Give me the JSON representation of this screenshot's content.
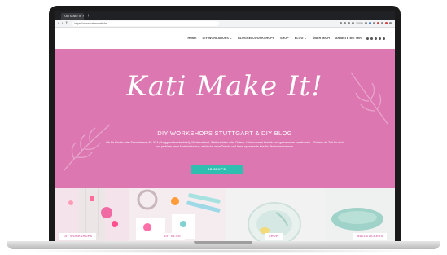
{
  "browser": {
    "tab_title": "Kati Make It! ×",
    "new_tab": "+",
    "url": "https://www.katimakeit.de",
    "zoom": "100%"
  },
  "nav": {
    "items": [
      "HOME",
      "DIY WORKSHOPS ⌄",
      "BLOGGER-WORKSHOPS",
      "SHOP",
      "BLOG ⌄",
      "ÜBER MICH",
      "ARBEITE MIT MIR"
    ]
  },
  "hero": {
    "logo": "Kati Make It!",
    "title": "DIY WORKSHOPS STUTTGART & DIY BLOG",
    "text": "Ob für Kinder oder Erwachsene, für JGA (Junggesellenabschied), Mädelsabend, Weihnachten oder Ostern: Unbeschwert basteln und gemeinsam kreativ sein – Schenk dir Zeit für dich und probiere neue Materialien aus, entdecke neue Trends und lerne spannende Kreativ-Techniken kennen.",
    "cta": "SO GEHT'S",
    "background": "#dd77b2",
    "button_color": "#2fbeb0"
  },
  "tiles": [
    {
      "label": "DIY WORKSHOPS"
    },
    {
      "label": "DIY BLOG"
    },
    {
      "label": "SHOP"
    },
    {
      "label": "WALLSTICKERS"
    }
  ]
}
